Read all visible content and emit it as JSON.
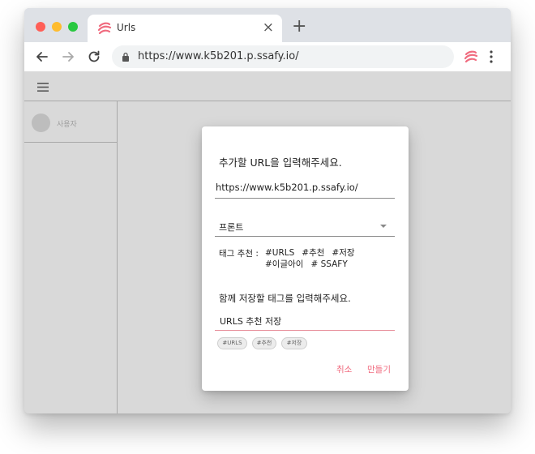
{
  "browser": {
    "tab_title": "Urls",
    "tab_close": "×",
    "new_tab": "+",
    "url": "https://www.k5b201.p.ssafy.io/",
    "accent_color": "#f06b7f"
  },
  "app": {
    "username": "사용자"
  },
  "dialog": {
    "title": "추가할 URL을 입력해주세요.",
    "url_value": "https://www.k5b201.p.ssafy.io/",
    "category_value": "프론트",
    "recommend_label": "태그 추천 :",
    "recommended_tags": [
      "#URLS",
      "#추천",
      "#저장",
      "#이글아이",
      "# SSAFY"
    ],
    "tag_prompt": "함께 저장할 태그를 입력해주세요.",
    "tag_input_value": "URLS 추천 저장",
    "chips": [
      "#URLS",
      "#추천",
      "#저장"
    ],
    "cancel_label": "취소",
    "create_label": "만들기"
  }
}
